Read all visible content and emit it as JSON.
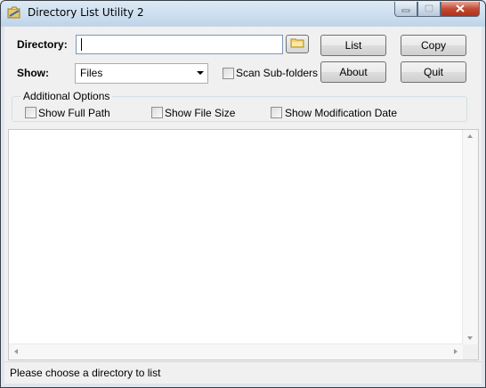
{
  "window": {
    "title": "Directory List Utility 2"
  },
  "form": {
    "directory_label": "Directory:",
    "directory_value": "",
    "show_label": "Show:",
    "show_selected": "Files",
    "scan_subfolders_label": "Scan Sub-folders",
    "scan_subfolders_checked": false
  },
  "buttons": {
    "list": "List",
    "copy": "Copy",
    "about": "About",
    "quit": "Quit"
  },
  "options": {
    "title": "Additional Options",
    "show_full_path": "Show Full Path",
    "show_file_size": "Show File Size",
    "show_modification_date": "Show Modification Date"
  },
  "status": {
    "text": "Please choose a directory to list"
  },
  "icons": {
    "app": "directory-list-app-icon",
    "browse": "folder-icon",
    "minimize": "minimize-icon",
    "maximize": "maximize-icon",
    "close": "close-icon"
  }
}
